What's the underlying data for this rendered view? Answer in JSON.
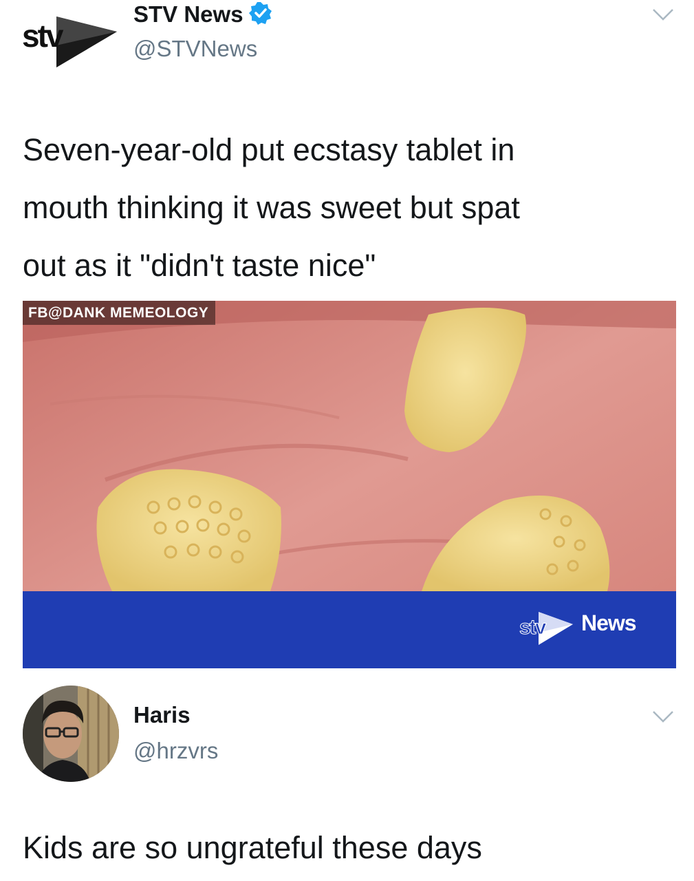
{
  "tweets": [
    {
      "name": "STV News",
      "handle": "@STVNews",
      "verified": true,
      "text_lines": [
        "Seven-year-old put ecstasy tablet in",
        "mouth thinking it was sweet but spat",
        "out as it \"didn't taste nice\""
      ],
      "media": {
        "watermark": "FB@DANK MEMEOLOGY",
        "news_label": "News"
      },
      "avatar_logo": "stv-logo"
    },
    {
      "name": "Haris",
      "handle": "@hrzvrs",
      "text": "Kids are so ungrateful these days",
      "avatar": "profile-photo"
    }
  ],
  "icons": {
    "verified": "verified-badge-icon",
    "menu": "chevron-down-icon"
  },
  "colors": {
    "verified_blue": "#1da1f2",
    "handle_gray": "#657786",
    "news_bar_blue": "#1f3db3",
    "text": "#14171a"
  }
}
